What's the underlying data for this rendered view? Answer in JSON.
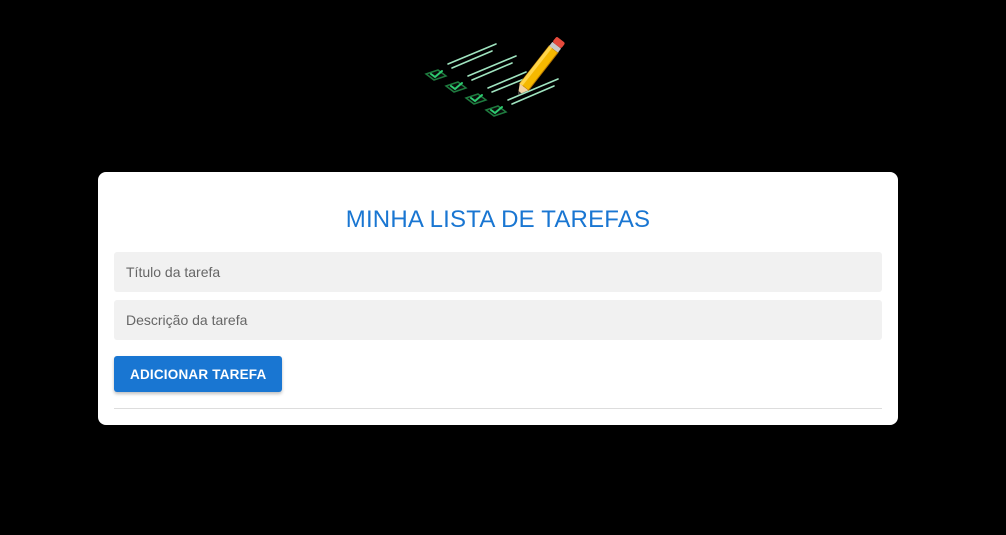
{
  "header": {
    "logo_icon": "checklist-with-pencil-icon"
  },
  "form": {
    "title": "MINHA LISTA DE TAREFAS",
    "title_placeholder": "Título da tarefa",
    "description_placeholder": "Descrição da tarefa",
    "add_button_label": "ADICIONAR TAREFA"
  },
  "colors": {
    "background": "#000000",
    "card": "#ffffff",
    "accent": "#1976d2",
    "input_bg": "#f1f1f1",
    "check_green": "#2ecc71",
    "pencil_yellow": "#f5b800"
  },
  "tasks": []
}
